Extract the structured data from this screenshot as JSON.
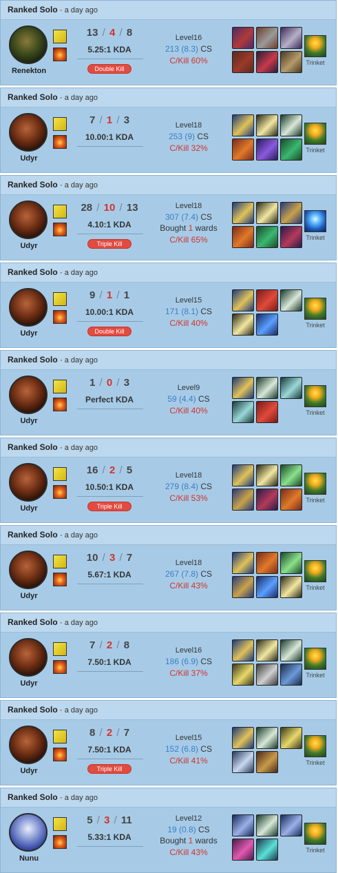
{
  "matches": [
    {
      "queue": "Ranked Solo",
      "ago": "a day ago",
      "champion": "Renekton",
      "champion_icon": "renekton-portrait-icon",
      "kills": "13",
      "deaths": "4",
      "assists": "8",
      "kda_ratio": "5.25:1 KDA",
      "multikill": "Double Kill",
      "level": "Level16",
      "cs_value": "213 (8.3)",
      "cs_label": "CS",
      "wards": null,
      "ckill": "C/Kill 60%",
      "trinket_label": "Trinket",
      "trinket_color": "yellow",
      "items": [
        [
          "#4a2b6a",
          "#b13a3a"
        ],
        [
          "#6e3f2a",
          "#9a9a9a"
        ],
        [
          "#3d2b5a",
          "#b6b0c8"
        ],
        [
          "#5a2a1e",
          "#9b3a2a"
        ],
        [
          "#2a1e36",
          "#c73a4a"
        ],
        [
          "#4a3a22",
          "#b59a6a"
        ]
      ]
    },
    {
      "queue": "Ranked Solo",
      "ago": "a day ago",
      "champion": "Udyr",
      "champion_icon": "udyr-portrait-icon",
      "kills": "7",
      "deaths": "1",
      "assists": "3",
      "kda_ratio": "10.00:1 KDA",
      "multikill": null,
      "level": "Level18",
      "cs_value": "253 (9)",
      "cs_label": "CS",
      "wards": null,
      "ckill": "C/Kill 32%",
      "trinket_label": "Trinket",
      "trinket_color": "yellow",
      "items": [
        [
          "#1e3a7a",
          "#e0c25a"
        ],
        [
          "#2a2a1a",
          "#f2e7a0"
        ],
        [
          "#1a3a2a",
          "#d8e8d8"
        ],
        [
          "#7a2a1a",
          "#e07a2a"
        ],
        [
          "#2a1a5a",
          "#8a5ae0"
        ],
        [
          "#1a4a2a",
          "#3ab870"
        ]
      ]
    },
    {
      "queue": "Ranked Solo",
      "ago": "a day ago",
      "champion": "Udyr",
      "champion_icon": "udyr-portrait-icon",
      "kills": "28",
      "deaths": "10",
      "assists": "13",
      "kda_ratio": "4.10:1 KDA",
      "multikill": "Triple Kill",
      "level": "Level18",
      "cs_value": "307 (7.4)",
      "cs_label": "CS",
      "wards": {
        "pre": "Bought ",
        "n": "1",
        "post": " wards"
      },
      "ckill": "C/Kill 65%",
      "trinket_label": "Trinket",
      "trinket_color": "blue",
      "items": [
        [
          "#1e3a7a",
          "#e0c25a"
        ],
        [
          "#2a2a1a",
          "#f2e7a0"
        ],
        [
          "#2a3a7a",
          "#c8a24a"
        ],
        [
          "#7a2a1a",
          "#e07a2a"
        ],
        [
          "#1a4a2a",
          "#3ab870"
        ],
        [
          "#2a1a4a",
          "#b33a5a"
        ]
      ]
    },
    {
      "queue": "Ranked Solo",
      "ago": "a day ago",
      "champion": "Udyr",
      "champion_icon": "udyr-portrait-icon",
      "kills": "9",
      "deaths": "1",
      "assists": "1",
      "kda_ratio": "10.00:1 KDA",
      "multikill": "Double Kill",
      "level": "Level15",
      "cs_value": "171 (8.1)",
      "cs_label": "CS",
      "wards": null,
      "ckill": "C/Kill 40%",
      "trinket_label": "Trinket",
      "trinket_color": "yellow",
      "items": [
        [
          "#1e3a7a",
          "#e0c25a"
        ],
        [
          "#7a1a1a",
          "#e04a3a"
        ],
        [
          "#1a3a2a",
          "#d8e8d8"
        ],
        [
          "#2a2a1a",
          "#f2e7a0"
        ],
        [
          "#1a2a6a",
          "#5aa0ff"
        ]
      ]
    },
    {
      "queue": "Ranked Solo",
      "ago": "a day ago",
      "champion": "Udyr",
      "champion_icon": "udyr-portrait-icon",
      "kills": "1",
      "deaths": "0",
      "assists": "3",
      "kda_ratio": "Perfect KDA",
      "multikill": null,
      "level": "Level9",
      "cs_value": "59 (4.4)",
      "cs_label": "CS",
      "wards": null,
      "ckill": "C/Kill 40%",
      "trinket_label": "Trinket",
      "trinket_color": "yellow",
      "items": [
        [
          "#1e3a7a",
          "#e0c25a"
        ],
        [
          "#1a3a2a",
          "#d8e8d8"
        ],
        [
          "#1a3a3a",
          "#9ad8d8"
        ],
        [
          "#1a3a3a",
          "#9ad8d8"
        ],
        [
          "#7a1a1a",
          "#e04a3a"
        ]
      ]
    },
    {
      "queue": "Ranked Solo",
      "ago": "a day ago",
      "champion": "Udyr",
      "champion_icon": "udyr-portrait-icon",
      "kills": "16",
      "deaths": "2",
      "assists": "5",
      "kda_ratio": "10.50:1 KDA",
      "multikill": "Triple Kill",
      "level": "Level18",
      "cs_value": "279 (8.4)",
      "cs_label": "CS",
      "wards": null,
      "ckill": "C/Kill 53%",
      "trinket_label": "Trinket",
      "trinket_color": "yellow",
      "items": [
        [
          "#1e3a7a",
          "#e0c25a"
        ],
        [
          "#2a2a1a",
          "#f2e7a0"
        ],
        [
          "#1a4a2a",
          "#8ae08a"
        ],
        [
          "#2a3a7a",
          "#c8a24a"
        ],
        [
          "#2a1a4a",
          "#b33a5a"
        ],
        [
          "#7a2a1a",
          "#e07a2a"
        ]
      ]
    },
    {
      "queue": "Ranked Solo",
      "ago": "a day ago",
      "champion": "Udyr",
      "champion_icon": "udyr-portrait-icon",
      "kills": "10",
      "deaths": "3",
      "assists": "7",
      "kda_ratio": "5.67:1 KDA",
      "multikill": null,
      "level": "Level18",
      "cs_value": "267 (7.8)",
      "cs_label": "CS",
      "wards": null,
      "ckill": "C/Kill 43%",
      "trinket_label": "Trinket",
      "trinket_color": "yellow",
      "items": [
        [
          "#1e3a7a",
          "#e0c25a"
        ],
        [
          "#7a2a1a",
          "#e07a2a"
        ],
        [
          "#1a4a2a",
          "#8ae08a"
        ],
        [
          "#2a3a7a",
          "#c8a24a"
        ],
        [
          "#1a2a6a",
          "#5aa0ff"
        ],
        [
          "#2a2a1a",
          "#f2e7a0"
        ]
      ]
    },
    {
      "queue": "Ranked Solo",
      "ago": "a day ago",
      "champion": "Udyr",
      "champion_icon": "udyr-portrait-icon",
      "kills": "7",
      "deaths": "2",
      "assists": "8",
      "kda_ratio": "7.50:1 KDA",
      "multikill": null,
      "level": "Level16",
      "cs_value": "186 (6.9)",
      "cs_label": "CS",
      "wards": null,
      "ckill": "C/Kill 37%",
      "trinket_label": "Trinket",
      "trinket_color": "yellow",
      "items": [
        [
          "#1e3a7a",
          "#e0c25a"
        ],
        [
          "#2a2a1a",
          "#f2e7a0"
        ],
        [
          "#1a3a2a",
          "#d8e8d8"
        ],
        [
          "#3a3a1a",
          "#e8d86a"
        ],
        [
          "#3a3a3a",
          "#d0d0d0"
        ],
        [
          "#1a2a4a",
          "#6a9ad8"
        ]
      ]
    },
    {
      "queue": "Ranked Solo",
      "ago": "a day ago",
      "champion": "Udyr",
      "champion_icon": "udyr-portrait-icon",
      "kills": "8",
      "deaths": "2",
      "assists": "7",
      "kda_ratio": "7.50:1 KDA",
      "multikill": "Triple Kill",
      "level": "Level15",
      "cs_value": "152 (6.8)",
      "cs_label": "CS",
      "wards": null,
      "ckill": "C/Kill 41%",
      "trinket_label": "Trinket",
      "trinket_color": "yellow",
      "items": [
        [
          "#1e3a7a",
          "#e0c25a"
        ],
        [
          "#1a3a2a",
          "#d8e8d8"
        ],
        [
          "#3a3a1a",
          "#e8d86a"
        ],
        [
          "#2a3a5a",
          "#c8d8f0"
        ],
        [
          "#4a2a1a",
          "#c89a4a"
        ]
      ]
    },
    {
      "queue": "Ranked Solo",
      "ago": "a day ago",
      "champion": "Nunu",
      "champion_icon": "nunu-portrait-icon",
      "kills": "5",
      "deaths": "3",
      "assists": "11",
      "kda_ratio": "5.33:1 KDA",
      "multikill": null,
      "level": "Level12",
      "cs_value": "19 (0.8)",
      "cs_label": "CS",
      "wards": {
        "pre": "Bought ",
        "n": "1",
        "post": " wards"
      },
      "ckill": "C/Kill 43%",
      "trinket_label": "Trinket",
      "trinket_color": "yellow",
      "items": [
        [
          "#1a2a5a",
          "#9ab0e8"
        ],
        [
          "#1a3a2a",
          "#d8e8d8"
        ],
        [
          "#1a2a5a",
          "#9ab0e8"
        ],
        [
          "#4a1a4a",
          "#e05ab0"
        ],
        [
          "#1a3a4a",
          "#5ae0d8"
        ]
      ]
    }
  ]
}
